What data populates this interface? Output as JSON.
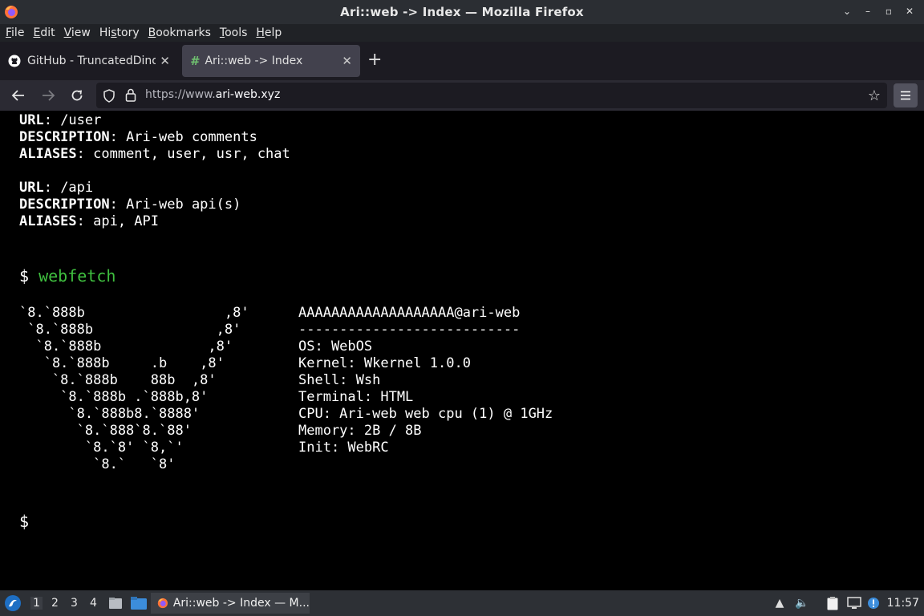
{
  "window": {
    "title": "Ari::web -> Index — Mozilla Firefox"
  },
  "menu": {
    "items": [
      {
        "pre": "",
        "acc": "F",
        "post": "ile"
      },
      {
        "pre": "",
        "acc": "E",
        "post": "dit"
      },
      {
        "pre": "",
        "acc": "V",
        "post": "iew"
      },
      {
        "pre": "Hi",
        "acc": "s",
        "post": "tory"
      },
      {
        "pre": "",
        "acc": "B",
        "post": "ookmarks"
      },
      {
        "pre": "",
        "acc": "T",
        "post": "ools"
      },
      {
        "pre": "",
        "acc": "H",
        "post": "elp"
      }
    ]
  },
  "tabs": [
    {
      "label": "GitHub - TruncatedDinos",
      "icon": "github-icon"
    },
    {
      "label": "Ari::web -> Index",
      "icon": "hash-icon"
    }
  ],
  "address": {
    "prefix": "https://www.",
    "domain": "ari-web.xyz"
  },
  "terminal": {
    "user_block": {
      "url_key": "URL",
      "url_val": ": /user",
      "desc_key": "DESCRIPTION",
      "desc_val": ": Ari-web comments",
      "alias_key": "ALIASES",
      "alias_val": ": comment, user, usr, chat"
    },
    "api_block": {
      "url_key": "URL",
      "url_val": ": /api",
      "desc_key": "DESCRIPTION",
      "desc_val": ": Ari-web api(s)",
      "alias_key": "ALIASES",
      "alias_val": ": api, API"
    },
    "prompt_symbol": "$",
    "command": "webfetch",
    "ascii_art": [
      "`8.`888b                 ,8'",
      " `8.`888b               ,8'",
      "  `8.`888b             ,8'",
      "   `8.`888b     .b    ,8'",
      "    `8.`888b    88b  ,8'",
      "     `8.`888b .`888b,8'",
      "      `8.`888b8.`8888'",
      "       `8.`888`8.`88'",
      "        `8.`8' `8,`'",
      "         `8.`   `8'"
    ],
    "info": [
      "AAAAAAAAAAAAAAAAAAA@ari-web",
      "---------------------------",
      "OS: WebOS",
      "Kernel: Wkernel 1.0.0",
      "Shell: Wsh",
      "Terminal: HTML",
      "CPU: Ari-web web cpu (1) @ 1GHz",
      "Memory: 2B / 8B",
      "Init: WebRC"
    ],
    "final_prompt": "$"
  },
  "taskbar": {
    "workspaces": [
      "1",
      "2",
      "3",
      "4"
    ],
    "active_app": "Ari::web -> Index — M...",
    "clock": "11:57"
  },
  "colors": {
    "command_green": "#3fbf3f",
    "background": "#000000"
  }
}
